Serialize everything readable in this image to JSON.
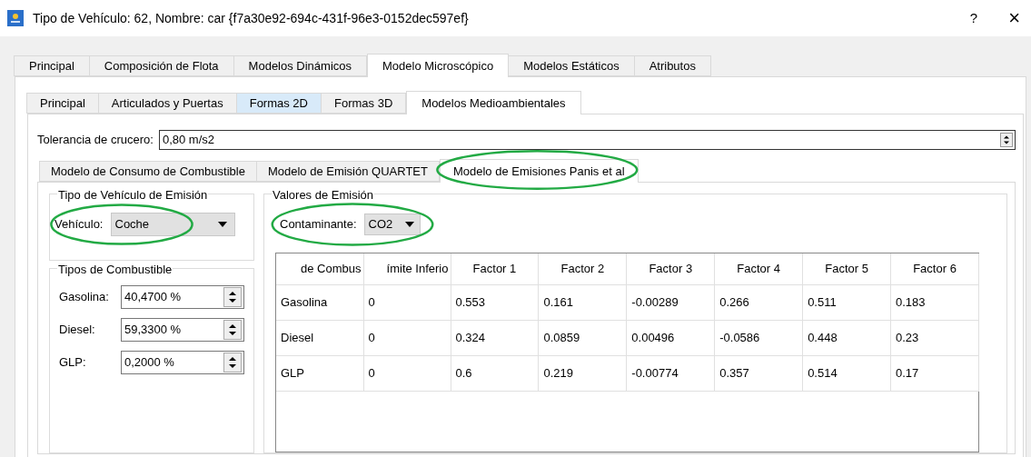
{
  "window": {
    "title": "Tipo de Vehículo: 62, Nombre: car {f7a30e92-694c-431f-96e3-0152dec597ef}",
    "help": "?",
    "close": "×"
  },
  "tabs": [
    {
      "label": "Principal",
      "selected": false
    },
    {
      "label": "Composición de Flota",
      "selected": false
    },
    {
      "label": "Modelos Dinámicos",
      "selected": false
    },
    {
      "label": "Modelo Microscópico",
      "selected": true
    },
    {
      "label": "Modelos Estáticos",
      "selected": false
    },
    {
      "label": "Atributos",
      "selected": false
    }
  ],
  "subtabs": [
    {
      "label": "Principal",
      "selected": false,
      "hovered": false
    },
    {
      "label": "Articulados y Puertas",
      "selected": false,
      "hovered": false
    },
    {
      "label": "Formas 2D",
      "selected": false,
      "hovered": true
    },
    {
      "label": "Formas 3D",
      "selected": false,
      "hovered": false
    },
    {
      "label": "Modelos Medioambientales",
      "selected": true,
      "hovered": false
    }
  ],
  "cruise_tolerance": {
    "label": "Tolerancia de crucero:",
    "value": "0,80 m/s2"
  },
  "model_tabs": [
    {
      "label": "Modelo de Consumo de Combustible",
      "selected": false,
      "highlighted": false
    },
    {
      "label": "Modelo de Emisión QUARTET",
      "selected": false,
      "highlighted": false
    },
    {
      "label": "Modelo de Emisiones Panis et al",
      "selected": true,
      "highlighted": true
    }
  ],
  "vehicle_group": {
    "title": "Tipo de Vehículo de Emisión",
    "label": "Vehículo:",
    "value": "Coche",
    "highlighted": true
  },
  "fuel_group": {
    "title": "Tipos de Combustible",
    "fields": [
      {
        "label": "Gasolina:",
        "value": "40,4700 %"
      },
      {
        "label": "Diesel:",
        "value": "59,3300 %"
      },
      {
        "label": "GLP:",
        "value": "0,2000 %"
      }
    ]
  },
  "emission_group": {
    "title": "Valores de Emisión",
    "label": "Contaminante:",
    "value": "CO2",
    "highlighted": true
  },
  "table": {
    "columns": [
      "de Combus",
      "ímite Inferio",
      "Factor 1",
      "Factor 2",
      "Factor 3",
      "Factor 4",
      "Factor 5",
      "Factor 6"
    ],
    "rows": [
      [
        "Gasolina",
        "0",
        "0.553",
        "0.161",
        "-0.00289",
        "0.266",
        "0.511",
        "0.183"
      ],
      [
        "Diesel",
        "0",
        "0.324",
        "0.0859",
        "0.00496",
        "-0.0586",
        "0.448",
        "0.23"
      ],
      [
        "GLP",
        "0",
        "0.6",
        "0.219",
        "-0.00774",
        "0.357",
        "0.514",
        "0.17"
      ]
    ]
  }
}
